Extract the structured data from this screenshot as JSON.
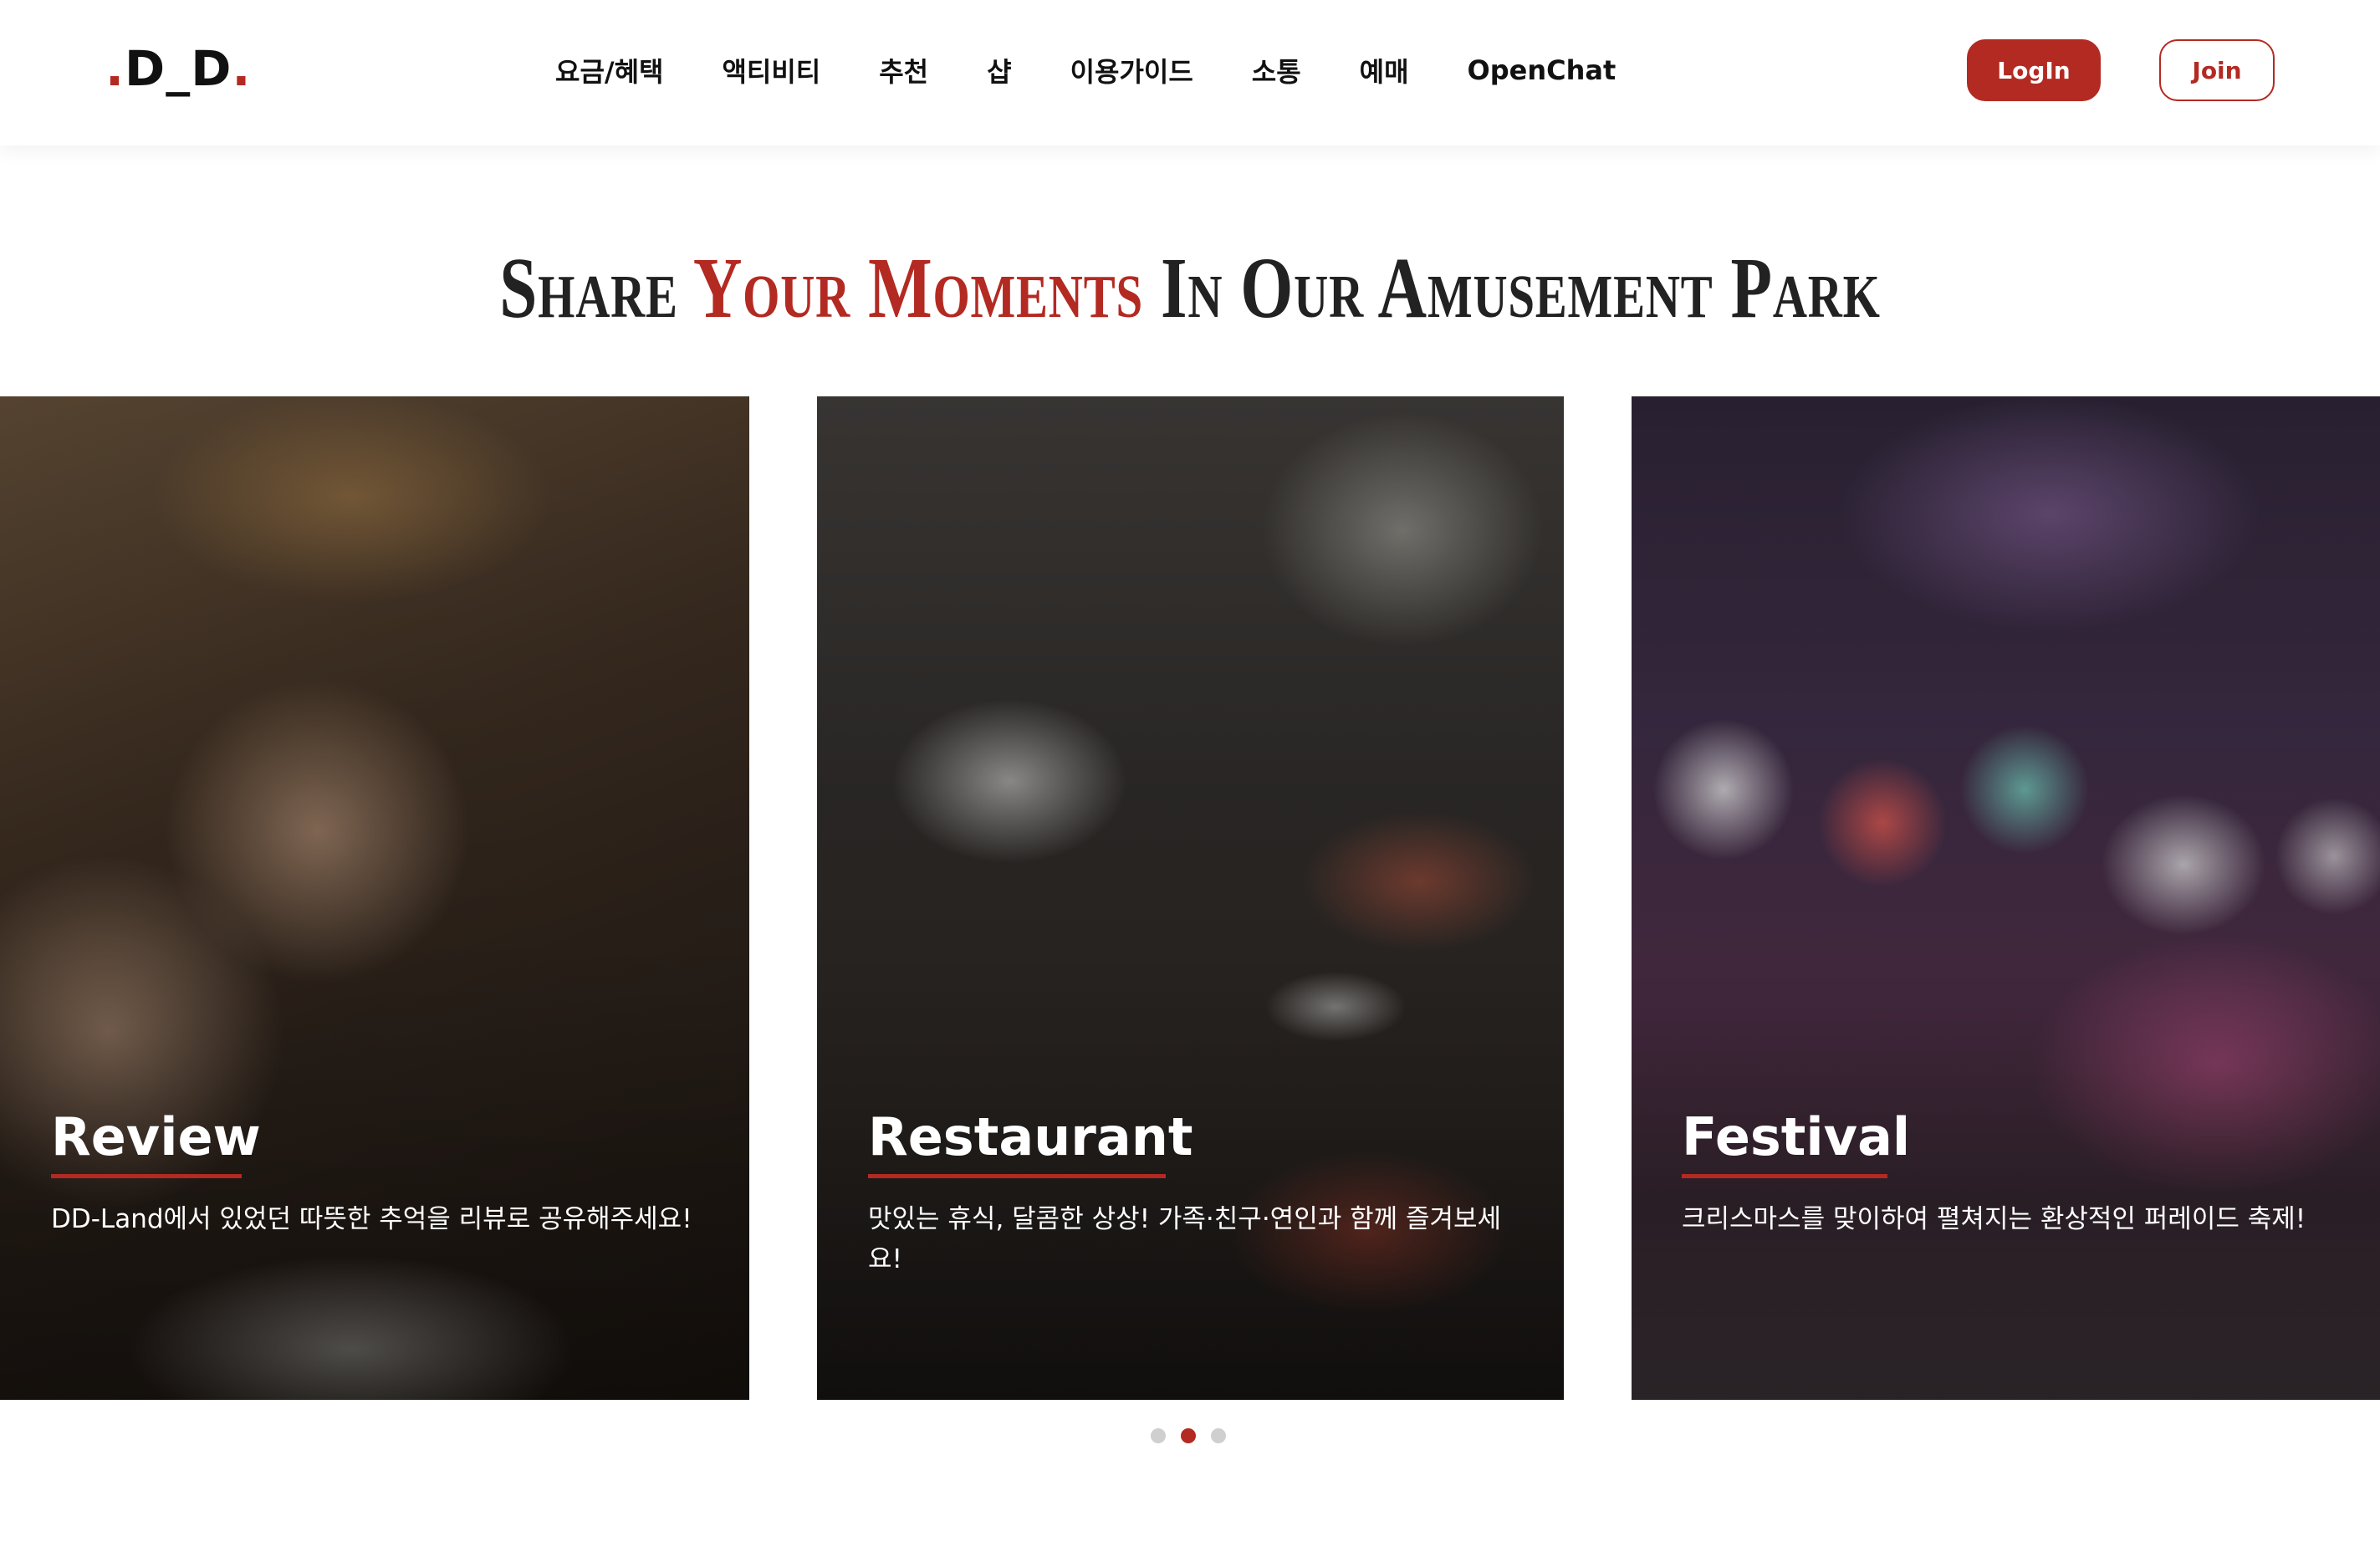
{
  "header": {
    "logo": {
      "prefix_dot": ".",
      "text": "D_D",
      "suffix_dot": "."
    },
    "nav": [
      "요금/혜택",
      "액티비티",
      "추천",
      "샵",
      "이용가이드",
      "소통",
      "예매",
      "OpenChat"
    ],
    "login_label": "LogIn",
    "join_label": "Join"
  },
  "section": {
    "title_part1": "Share ",
    "title_accent": "Your Moments",
    "title_part2": " In Our Amusement Park"
  },
  "cards": [
    {
      "title": "Review",
      "description": "DD-Land에서 있었던 따뜻한 추억을 리뷰로 공유해주세요!"
    },
    {
      "title": "Restaurant",
      "description": "맛있는 휴식, 달콤한 상상! 가족·친구·연인과 함께 즐겨보세요!"
    },
    {
      "title": "Festival",
      "description": "크리스마스를 맞이하여 펼쳐지는 환상적인 퍼레이드 축제!"
    }
  ],
  "carousel": {
    "total": 3,
    "active_index": 1
  },
  "colors": {
    "accent": "#b32a22"
  }
}
